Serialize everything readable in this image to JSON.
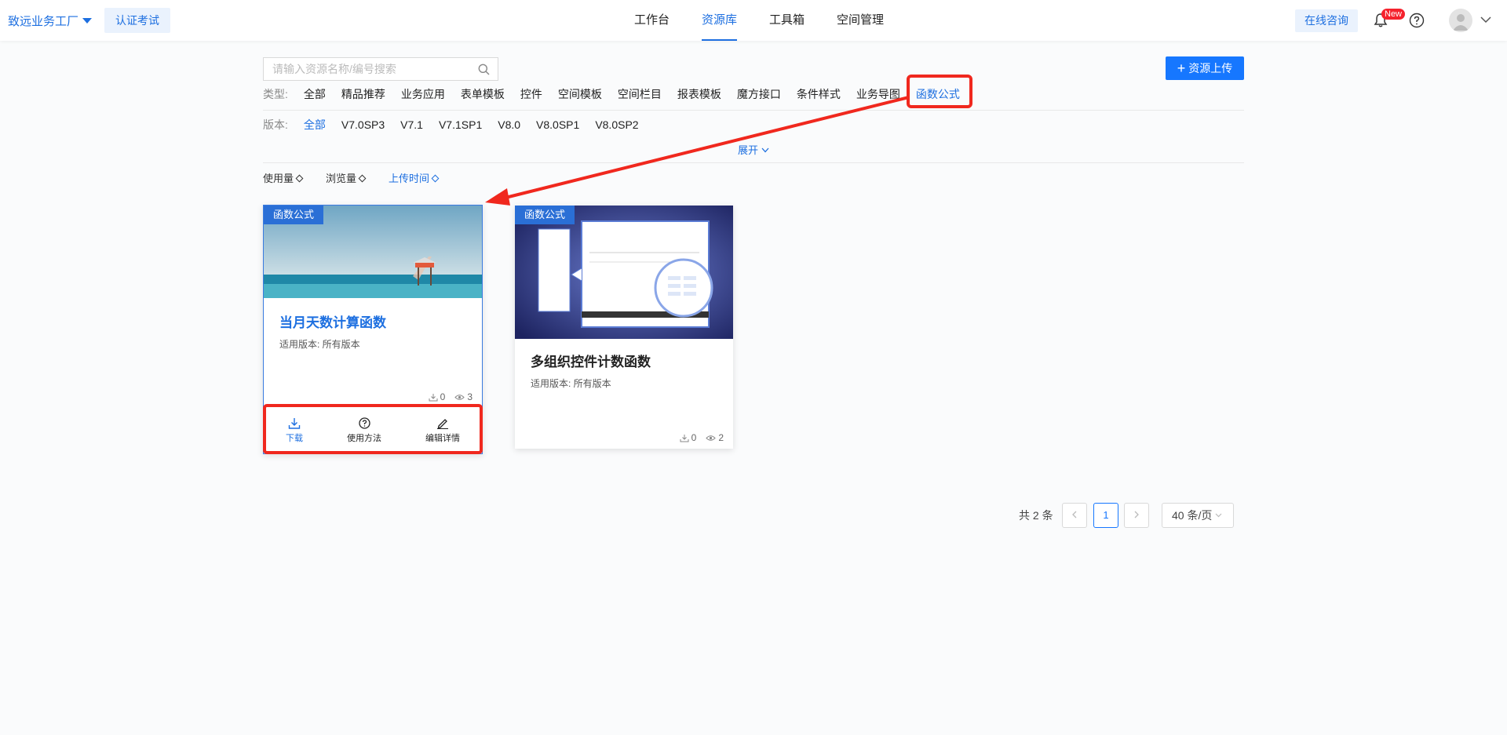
{
  "header": {
    "brand": "致远业务工厂",
    "cert_button": "认证考试",
    "nav": [
      "工作台",
      "资源库",
      "工具箱",
      "空间管理"
    ],
    "nav_active": 1,
    "consult": "在线咨询",
    "new_badge": "New"
  },
  "search": {
    "placeholder": "请输入资源名称/编号搜索",
    "value": ""
  },
  "upload_button": "资源上传",
  "filters": {
    "type_label": "类型:",
    "types": [
      "全部",
      "精品推荐",
      "业务应用",
      "表单模板",
      "控件",
      "空间模板",
      "空间栏目",
      "报表模板",
      "魔方接口",
      "条件样式",
      "业务导图",
      "函数公式"
    ],
    "version_label": "版本:",
    "versions": [
      "全部",
      "V7.0SP3",
      "V7.1",
      "V7.1SP1",
      "V8.0",
      "V8.0SP1",
      "V8.0SP2"
    ],
    "expand": "展开"
  },
  "sort": [
    "使用量",
    "浏览量",
    "上传时间"
  ],
  "cards": [
    {
      "tag": "函数公式",
      "title": "当月天数计算函数",
      "version": "适用版本:  所有版本",
      "downloads": "0",
      "views": "3",
      "actions": [
        "下载",
        "使用方法",
        "编辑详情"
      ]
    },
    {
      "tag": "函数公式",
      "title": "多组织控件计数函数",
      "version": "适用版本:  所有版本",
      "downloads": "0",
      "views": "2"
    }
  ],
  "pagination": {
    "total": "共 2 条",
    "current": "1",
    "page_size": "40 条/页"
  },
  "colors": {
    "primary": "#1677ff",
    "highlight": "#f0281e"
  }
}
